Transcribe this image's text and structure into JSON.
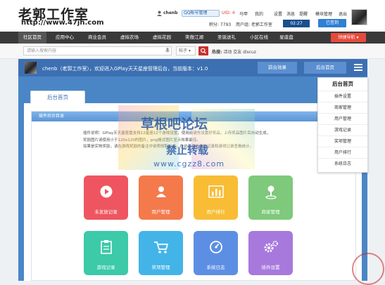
{
  "header": {
    "logo": "老郭工作室",
    "logo_url": "http://www.47jh.com",
    "username": "chenb",
    "qq_label": "QQ帐号管理",
    "uid": "UID: 4",
    "links": [
      "马甲",
      "我的",
      "设置",
      "消息",
      "提醒",
      "模块管理",
      "退出"
    ],
    "points": "积分: 7793",
    "group": "用户组: 老郭工作室",
    "timer": "02:27",
    "signed": "已签到"
  },
  "nav": {
    "items": [
      "社区首页",
      "应用中心",
      "商业会员",
      "虚拟农场",
      "虚拟花园",
      "笑傲江湖",
      "圣诞送礼",
      "小区在线",
      "星座盘"
    ],
    "quick": "快捷导航"
  },
  "search": {
    "placeholder": "请输入搜索内容",
    "type": "帖子",
    "hot_label": "热搜:",
    "hot_words": "活动 交友 discuz"
  },
  "welcome": {
    "text": "chenb（老郭工作室），欢迎进入GPlay天天星座管理后台，当前版本：v1.0",
    "btn_effect": "前台效果",
    "btn_admin": "后台首页"
  },
  "tab": "后台首页",
  "panel": {
    "heading": "插件后台目录",
    "desc": [
      "插件说明：GPlay天天星座盘支持12星座12个游戏设置，使用前请先设置好奖品，上传奖品图片后自动生成，",
      "奖励图片请使用小于120x120的图片，png格式图片显示效果最佳。",
      "如果是实物奖励，请在游戏奖励的备注中说明领取方式，在此可查看奖励记录和游戏记录查看统计。"
    ]
  },
  "tiles": [
    {
      "label": "未发放记录",
      "color": "#ef5560",
      "icon": "play-icon"
    },
    {
      "label": "用户管理",
      "color": "#f47a4c",
      "icon": "user-icon"
    },
    {
      "label": "用户排行",
      "color": "#f8bd35",
      "icon": "bar-chart-icon"
    },
    {
      "label": "商家管理",
      "color": "#7ec97b",
      "icon": "location-icon"
    },
    {
      "label": "游戏记录",
      "color": "#3ccaa9",
      "icon": "clipboard-icon"
    },
    {
      "label": "奖项管理",
      "color": "#43b4e8",
      "icon": "cart-icon"
    },
    {
      "label": "系统日志",
      "color": "#5c8fe3",
      "icon": "gauge-icon"
    },
    {
      "label": "插件设置",
      "color": "#a779dc",
      "icon": "gears-icon"
    }
  ],
  "dropdown": {
    "title": "后台首页",
    "items": [
      "插件设置",
      "商家管理",
      "用户管理",
      "游戏记录",
      "奖项管理",
      "用户排行",
      "系统日志"
    ]
  },
  "watermark": {
    "line1": "草根吧论坛",
    "line2": "禁止转载",
    "line3": "www.cgzz8.com"
  }
}
